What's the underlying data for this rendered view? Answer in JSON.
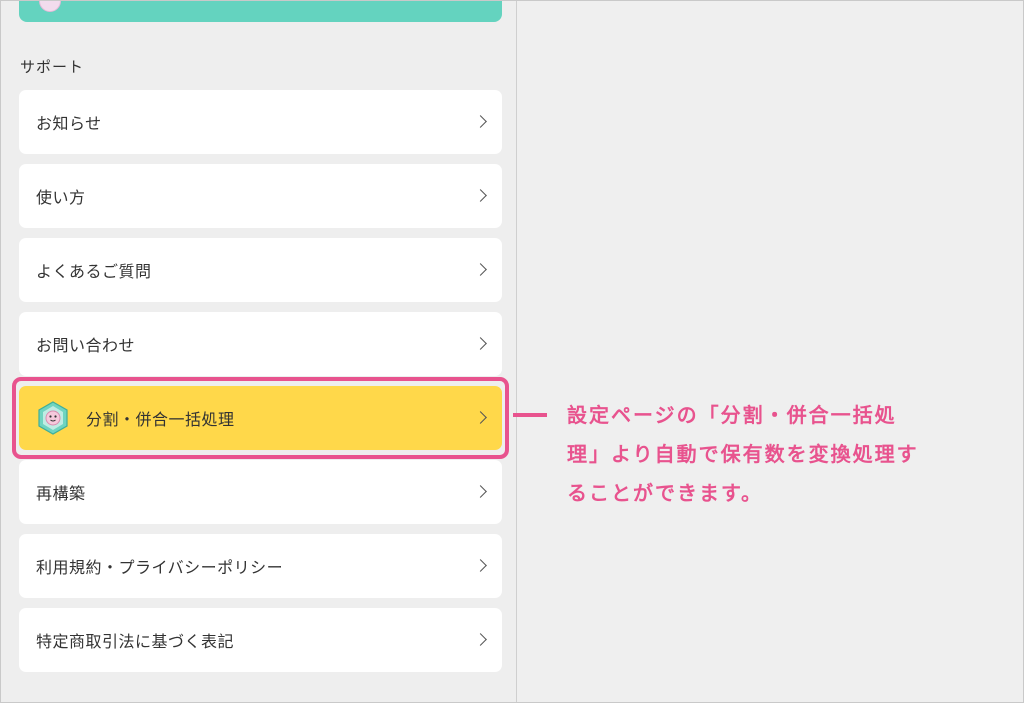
{
  "support": {
    "section_label": "サポート",
    "items": [
      {
        "label": "お知らせ"
      },
      {
        "label": "使い方"
      },
      {
        "label": "よくあるご質問"
      },
      {
        "label": "お問い合わせ"
      },
      {
        "label": "分割・併合一括処理"
      },
      {
        "label": "再構築"
      },
      {
        "label": "利用規約・プライバシーポリシー"
      },
      {
        "label": "特定商取引法に基づく表記"
      }
    ]
  },
  "callout": {
    "line1": "設定ページの「分割・併合一括処",
    "line2": "理」より自動で保有数を変換処理す",
    "line3": "ることができます。"
  },
  "colors": {
    "accent_pink": "#e8538e",
    "highlight_yellow": "#ffd84a",
    "top_card_green": "#64d3bf"
  }
}
